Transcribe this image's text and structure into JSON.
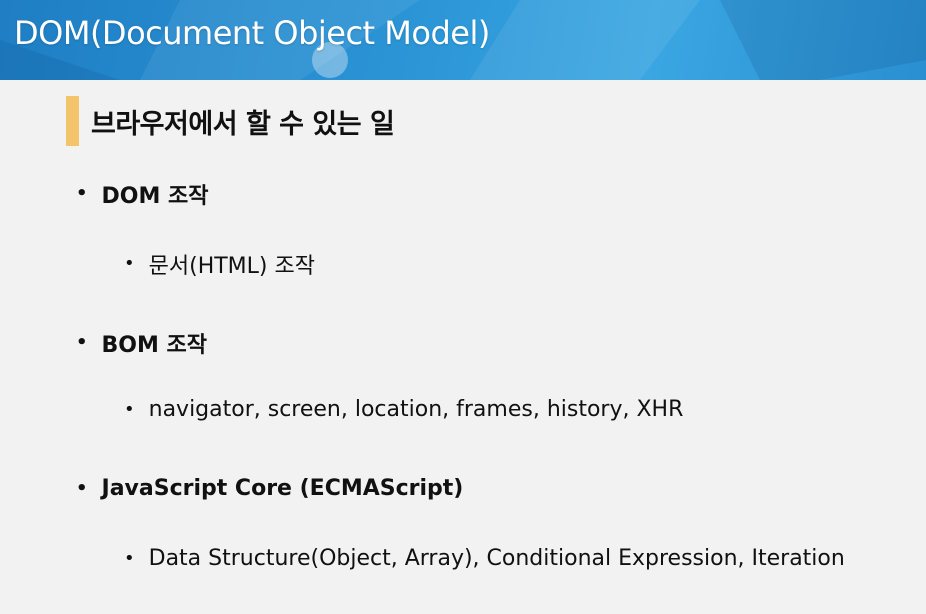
{
  "header": {
    "title": "DOM(Document Object Model)"
  },
  "section": {
    "title": "브라우저에서 할 수 있는 일",
    "accent": "#f3c46a"
  },
  "items": [
    {
      "label": "DOM 조작",
      "sub": "문서(HTML) 조작"
    },
    {
      "label": "BOM 조작",
      "sub": "navigator, screen, location, frames, history, XHR"
    },
    {
      "label": "JavaScript Core (ECMAScript)",
      "sub": "Data Structure(Object, Array), Conditional Expression, Iteration"
    }
  ],
  "bullet": "•",
  "colors": {
    "header": "#2b95d6",
    "background": "#f2f2f2",
    "text": "#111111"
  }
}
